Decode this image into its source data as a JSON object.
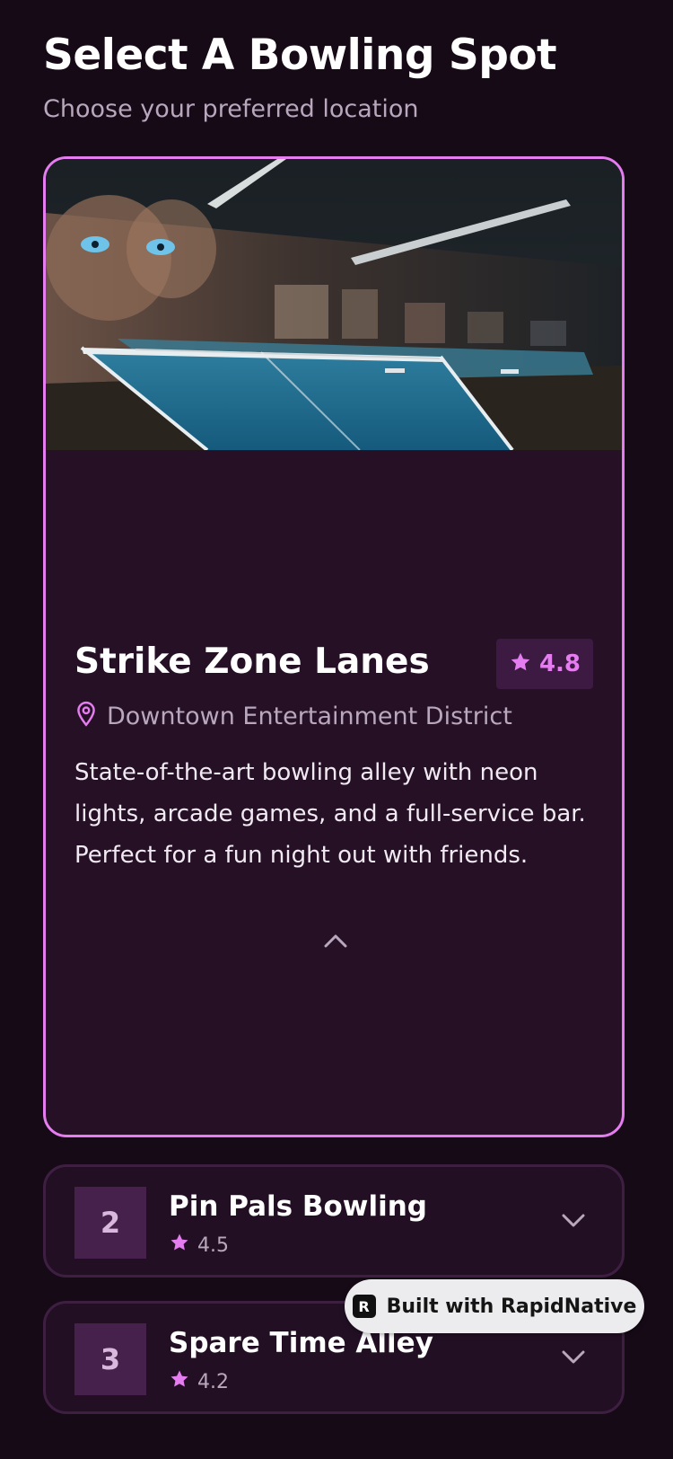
{
  "header": {
    "title": "Select A Bowling Spot",
    "subtitle": "Choose your preferred location"
  },
  "selected_venue": {
    "name": "Strike Zone Lanes",
    "rating": "4.8",
    "location": "Downtown Entertainment District",
    "description": "State-of-the-art bowling alley with neon lights, arcade games, and a full-service bar. Perfect for a fun night out with friends.",
    "image_alt": "Dimly lit hall with ping pong tables and murals"
  },
  "venues": [
    {
      "number": "2",
      "name": "Pin Pals Bowling",
      "rating": "4.5"
    },
    {
      "number": "3",
      "name": "Spare Time Alley",
      "rating": "4.2"
    }
  ],
  "badge": {
    "label": "Built with RapidNative",
    "logo_letter": "R"
  },
  "colors": {
    "background": "#160a17",
    "card": "#251026",
    "accent": "#e57df0",
    "muted_text": "#b9a7bd"
  },
  "icons": [
    "star-icon",
    "location-pin-icon",
    "chevron-up-icon",
    "chevron-down-icon",
    "rapidnative-logo-icon"
  ]
}
